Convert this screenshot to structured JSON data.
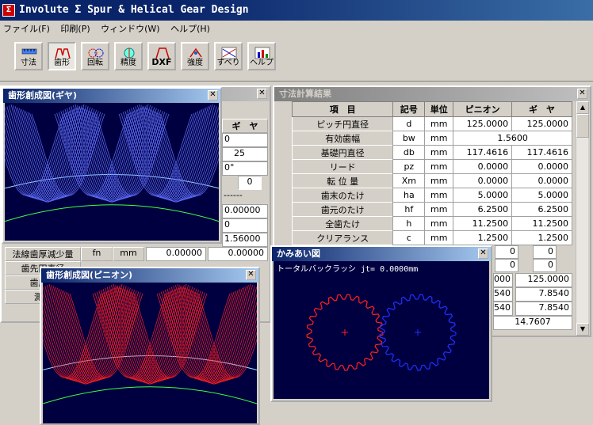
{
  "app": {
    "title": "Involute Σ  Spur & Helical Gear Design"
  },
  "menu": [
    "ファイル(F)",
    "印刷(P)",
    "ウィンドウ(W)",
    "ヘルプ(H)"
  ],
  "toolbar": [
    "寸法",
    "歯形",
    "回転",
    "精度",
    "DXF",
    "強度",
    "すべり",
    "ヘルプ"
  ],
  "results": {
    "title": "寸法計算結果",
    "headers": [
      "項　目",
      "記号",
      "単位",
      "ピニオン",
      "ギ　ヤ"
    ],
    "rows": [
      {
        "item": "ピッチ円直径",
        "sym": "d",
        "unit": "mm",
        "p": "125.0000",
        "g": "125.0000"
      },
      {
        "item": "有効歯幅",
        "sym": "bw",
        "unit": "mm",
        "merged": "1.5600"
      },
      {
        "item": "基礎円直径",
        "sym": "db",
        "unit": "mm",
        "p": "117.4616",
        "g": "117.4616"
      },
      {
        "item": "リード",
        "sym": "pz",
        "unit": "mm",
        "p": "0.0000",
        "g": "0.0000"
      },
      {
        "item": "転 位 量",
        "sym": "Xm",
        "unit": "mm",
        "p": "0.0000",
        "g": "0.0000"
      },
      {
        "item": "歯末のたけ",
        "sym": "ha",
        "unit": "mm",
        "p": "5.0000",
        "g": "5.0000"
      },
      {
        "item": "歯元のたけ",
        "sym": "hf",
        "unit": "mm",
        "p": "6.2500",
        "g": "6.2500"
      },
      {
        "item": "全歯たけ",
        "sym": "h",
        "unit": "mm",
        "p": "11.2500",
        "g": "11.2500"
      },
      {
        "item": "クリアランス",
        "sym": "c",
        "unit": "mm",
        "p": "1.2500",
        "g": "1.2500"
      }
    ],
    "partial": [
      "0",
      "0",
      "0",
      "0",
      "000",
      "125.0000",
      "540",
      "7.8540",
      "540",
      "7.8540",
      "14.7607"
    ]
  },
  "input_win": {
    "header": "ギ　ヤ",
    "values": [
      "0",
      "25",
      "0°",
      "0",
      "------",
      "0.00000",
      "0",
      "1.56000"
    ],
    "bottom_rows": [
      {
        "label": "法線歯厚減少量",
        "sym": "fn",
        "unit": "mm",
        "v1": "0.00000",
        "v2": "0.00000"
      },
      {
        "label": "歯先円直径",
        "sym": "",
        "unit": "",
        "v1": "",
        "v2": ""
      },
      {
        "label": "歯底円",
        "sym": "",
        "unit": "",
        "v1": "",
        "v2": ""
      },
      {
        "label": "測定",
        "sym": "",
        "unit": "",
        "v1": "",
        "v2": ""
      }
    ]
  },
  "gear_win": {
    "title": "歯形創成図(ギヤ)",
    "color": "#6070ff"
  },
  "pinion_win": {
    "title": "歯形創成図(ピニオン)",
    "color": "#ff2020"
  },
  "mesh_win": {
    "title": "かみあい図",
    "label": "トータルバックラッシ jt=    0.0000mm",
    "pinion_color": "#ff2020",
    "gear_color": "#2030ff"
  }
}
